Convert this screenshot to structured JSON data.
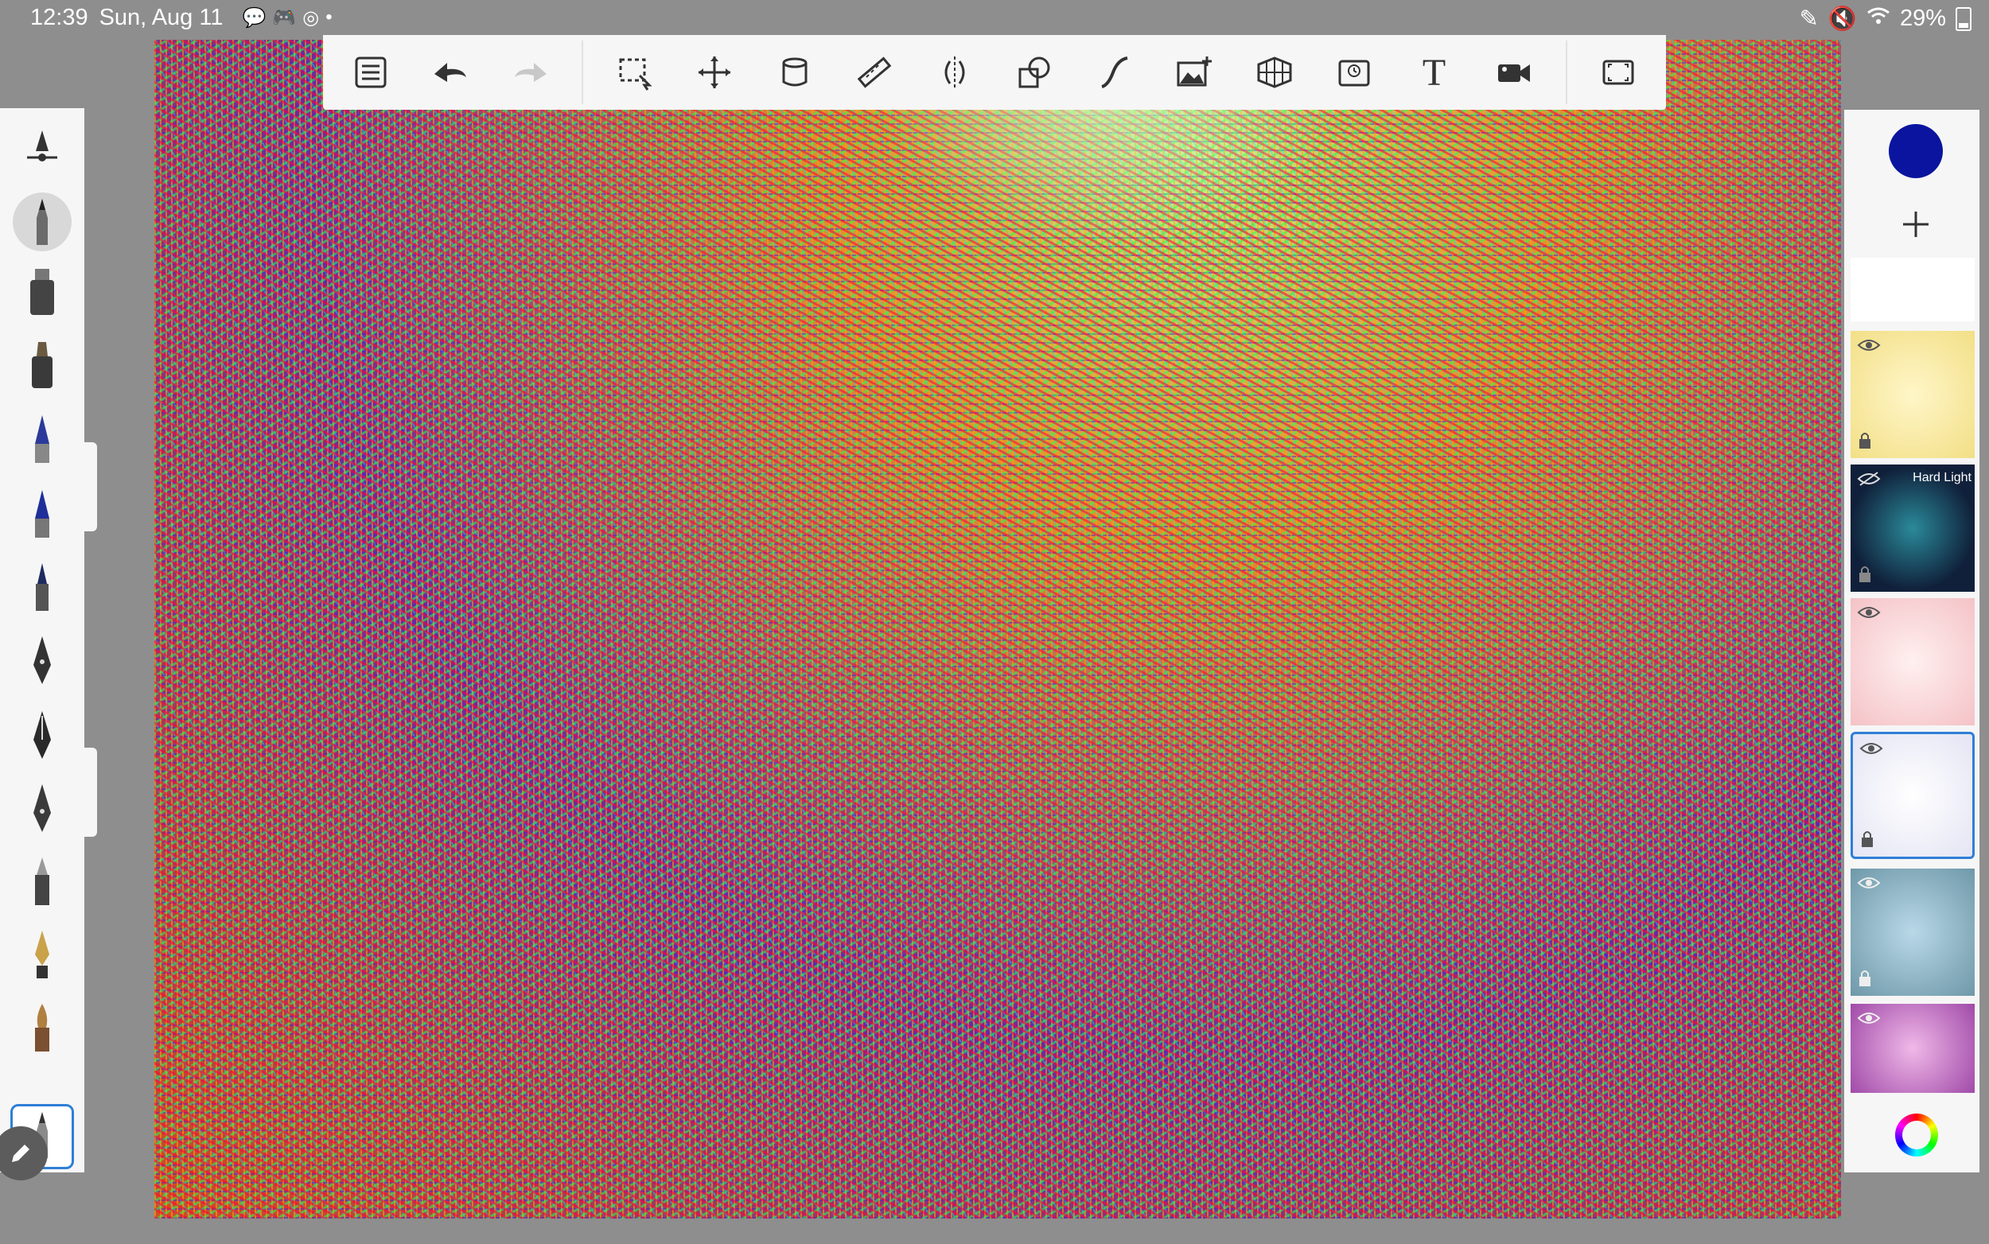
{
  "status_bar": {
    "time": "12:39",
    "date": "Sun, Aug 11",
    "left_icons": [
      "messenger-icon",
      "discord-icon",
      "sync-icon",
      "dot-icon"
    ],
    "right_icons": [
      "pen-icon",
      "mute-icon",
      "wifi-icon"
    ],
    "battery": "29%"
  },
  "toolbar": {
    "items": [
      {
        "name": "layers-list-icon"
      },
      {
        "name": "undo-icon"
      },
      {
        "name": "redo-icon"
      },
      {
        "name": "selection-icon"
      },
      {
        "name": "transform-icon"
      },
      {
        "name": "fill-bucket-icon"
      },
      {
        "name": "ruler-icon"
      },
      {
        "name": "symmetry-icon"
      },
      {
        "name": "shapes-icon"
      },
      {
        "name": "curve-icon"
      },
      {
        "name": "add-image-icon"
      },
      {
        "name": "perspective-grid-icon"
      },
      {
        "name": "time-lapse-icon"
      },
      {
        "name": "text-icon",
        "glyph": "T"
      },
      {
        "name": "video-record-icon"
      },
      {
        "name": "fullscreen-icon"
      }
    ]
  },
  "brushes": {
    "items": [
      "brush-settings",
      "pencil",
      "airbrush",
      "marker",
      "pen-blue",
      "pen-blue-2",
      "fineliner",
      "ink-pen",
      "calligraphy-pen",
      "nib-pen",
      "felt-tip",
      "fountain-pen",
      "paint-brush",
      "soft-pencil"
    ],
    "selected_index": 13
  },
  "layers_panel": {
    "current_color": "#0a149e",
    "layers": [
      {
        "name": "layer-background",
        "visible": true,
        "locked": false
      },
      {
        "name": "layer-yellow",
        "visible": true,
        "locked": true
      },
      {
        "name": "layer-dark-mandala",
        "visible": false,
        "locked": true,
        "blend": "Hard Light"
      },
      {
        "name": "layer-pink-mandala",
        "visible": true,
        "locked": false
      },
      {
        "name": "layer-lavender-mandala",
        "visible": true,
        "locked": true,
        "active": true
      },
      {
        "name": "layer-teal-mandala",
        "visible": true,
        "locked": false
      },
      {
        "name": "layer-magenta-mandala",
        "visible": true,
        "locked": false
      }
    ]
  }
}
